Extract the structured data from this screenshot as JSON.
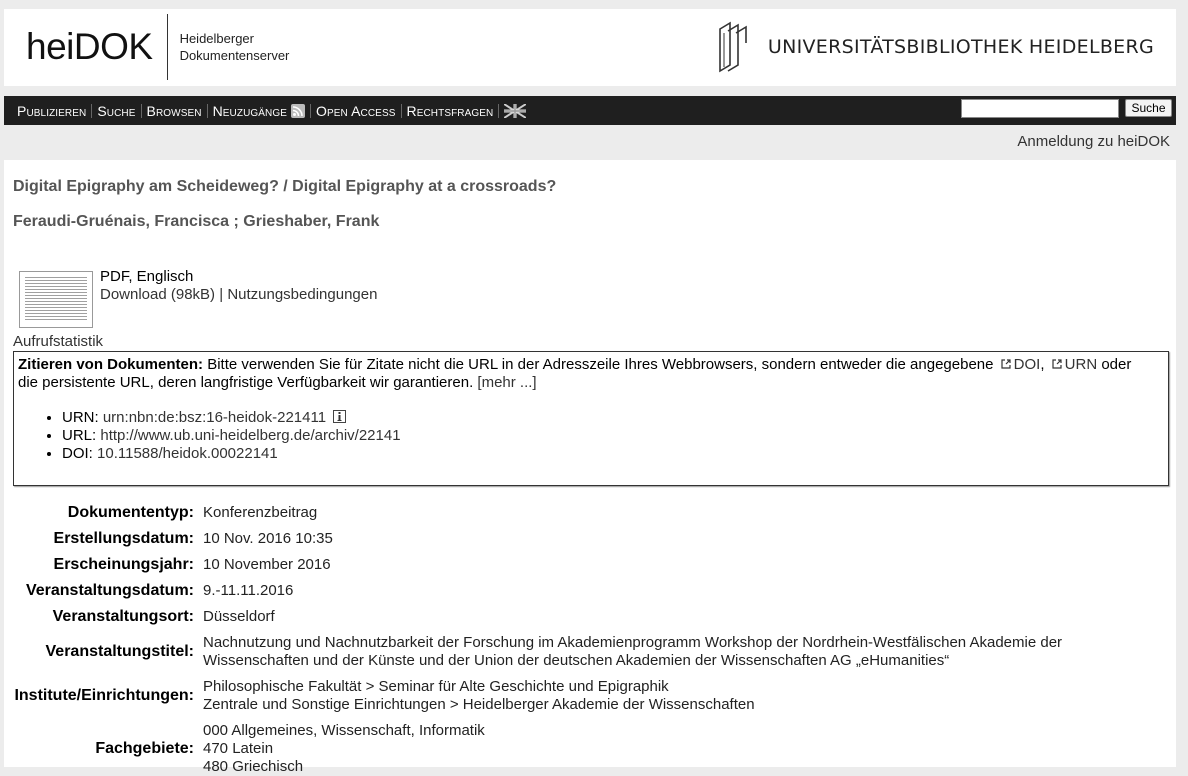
{
  "header": {
    "logo_main": "heiDOK",
    "logo_sub_line1": "Heidelberger",
    "logo_sub_line2": "Dokumentenserver",
    "library": "UNIVERSITÄTSBIBLIOTHEK HEIDELBERG"
  },
  "nav": {
    "items": [
      "Publizieren",
      "Suche",
      "Browsen",
      "Neuzugänge",
      "Open Access",
      "Rechtsfragen"
    ],
    "search_value": "",
    "search_button": "Suche",
    "rss_icon": "rss-icon",
    "flag_icon": "uk-flag-icon"
  },
  "login_link": "Anmeldung zu heiDOK",
  "document": {
    "title": "Digital Epigraphy am Scheideweg? / Digital Epigraphy at a crossroads?",
    "authors": "Feraudi-Gruénais, Francisca ; Grieshaber, Frank",
    "file_type": "PDF, Englisch",
    "download": "Download (98kB)",
    "separator": "|",
    "usage_terms": "Nutzungsbedingungen",
    "statistics": "Aufrufstatistik"
  },
  "citation": {
    "heading": "Zitieren von Dokumenten:",
    "text1": "Bitte verwenden Sie für Zitate nicht die URL in der Adresszeile Ihres Webbrowsers, sondern entweder die angegebene",
    "doi_link": "DOI",
    "comma": ",",
    "urn_link": "URN",
    "text2": "oder die persistente URL, deren langfristige Verfügbarkeit wir garantieren.",
    "more": "[mehr ...]",
    "urn_label": "URN:",
    "urn_value": "urn:nbn:de:bsz:16-heidok-221411",
    "url_label": "URL:",
    "url_value": "http://www.ub.uni-heidelberg.de/archiv/22141",
    "doi_label": "DOI:",
    "doi_value": "10.11588/heidok.00022141"
  },
  "metadata": [
    {
      "label": "Dokumententyp:",
      "values": [
        "Konferenzbeitrag"
      ]
    },
    {
      "label": "Erstellungsdatum:",
      "values": [
        "10 Nov. 2016 10:35"
      ]
    },
    {
      "label": "Erscheinungsjahr:",
      "values": [
        "10 November 2016"
      ]
    },
    {
      "label": "Veranstaltungsdatum:",
      "values": [
        "9.-11.11.2016"
      ]
    },
    {
      "label": "Veranstaltungsort:",
      "values": [
        "Düsseldorf"
      ]
    },
    {
      "label": "Veranstaltungstitel:",
      "values": [
        "Nachnutzung und Nachnutzbarkeit der Forschung im Akademienprogramm Workshop der Nordrhein-Westfälischen Akademie der",
        "Wissenschaften und der Künste und der Union der deutschen Akademien der Wissenschaften AG „eHumanities“"
      ]
    },
    {
      "label": "Institute/Einrichtungen:",
      "values": [
        "Philosophische Fakultät > Seminar für Alte Geschichte und Epigraphik",
        "Zentrale und Sonstige Einrichtungen > Heidelberger Akademie der Wissenschaften"
      ]
    },
    {
      "label": "Fachgebiete:",
      "values": [
        "000 Allgemeines, Wissenschaft, Informatik",
        "470 Latein",
        "480 Griechisch"
      ]
    }
  ]
}
